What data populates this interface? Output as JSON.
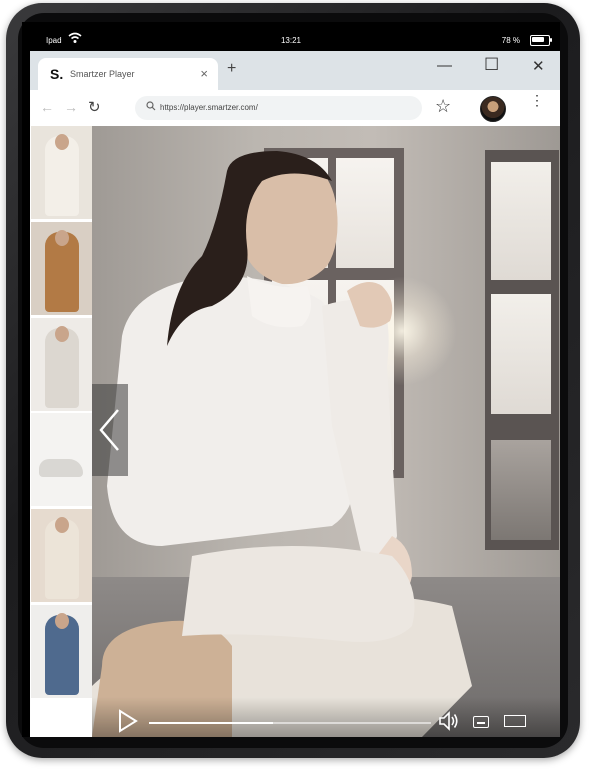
{
  "status_bar": {
    "carrier": "Ipad",
    "time": "13:21",
    "battery": "78 %"
  },
  "tab": {
    "favicon_text": "S.",
    "title": "Smartzer Player",
    "close_glyph": "×",
    "new_tab_glyph": "+"
  },
  "window_controls": {
    "minimize": "—",
    "maximize": "☐",
    "close": "✕"
  },
  "toolbar": {
    "back_glyph": "←",
    "forward_glyph": "→",
    "reload_glyph": "↻",
    "url": "https://player.smartzer.com/",
    "star_glyph": "☆",
    "menu_glyph": "⋮"
  },
  "product_rail": [
    {
      "name": "cream knit sweater",
      "bg": "#e9e4dc",
      "fg": "#f3efe8"
    },
    {
      "name": "camel puffer jacket",
      "bg": "#d9cfc4",
      "fg": "#b27a45"
    },
    {
      "name": "white trousers look",
      "bg": "#eeebe7",
      "fg": "#dcd7d0"
    },
    {
      "name": "white sneakers",
      "bg": "#f4f3f1",
      "fg": "#d9d7d3"
    },
    {
      "name": "bucket hat",
      "bg": "#e6dbcf",
      "fg": "#ece4d8"
    },
    {
      "name": "white top and jeans",
      "bg": "#efeeec",
      "fg": "#4f6a8e"
    }
  ],
  "player": {
    "progress": 0.44
  },
  "icons": {
    "prev": "chevron-left-icon",
    "play": "play-icon",
    "volume": "volume-icon",
    "captions": "captions-icon",
    "fullscreen": "fullscreen-icon"
  }
}
